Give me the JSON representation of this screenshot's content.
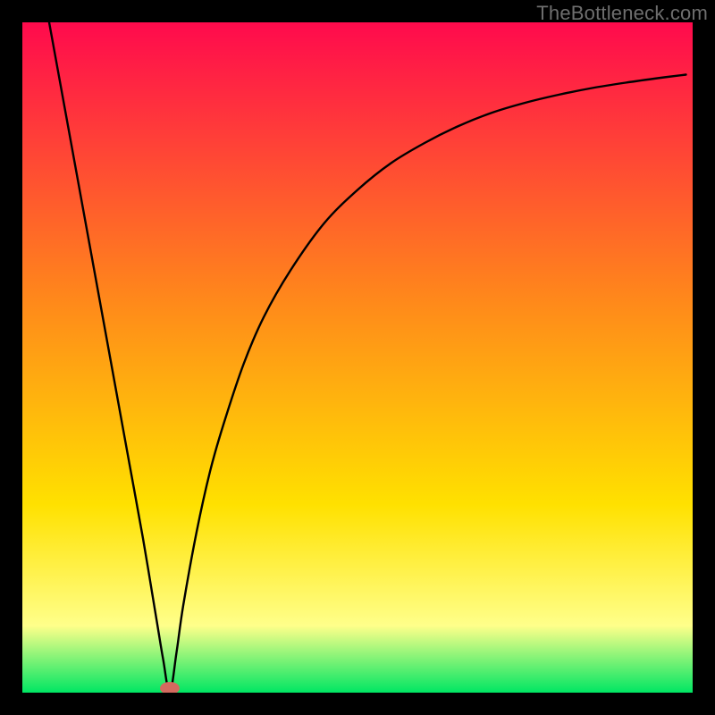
{
  "watermark": "TheBottleneck.com",
  "chart_data": {
    "type": "line",
    "title": "",
    "xlabel": "",
    "ylabel": "",
    "xlim": [
      0,
      100
    ],
    "ylim": [
      0,
      100
    ],
    "grid": false,
    "legend": false,
    "annotations": [],
    "marker": {
      "x": 22,
      "y": 0,
      "color": "#d46a5f"
    },
    "background_gradient": {
      "top": "#ff0a4d",
      "mid1": "#ff8a1a",
      "mid2": "#ffe100",
      "band": "#ffff8a",
      "bottom": "#00e663"
    },
    "series": [
      {
        "name": "curve",
        "color": "#000000",
        "x": [
          4,
          6,
          8,
          10,
          12,
          14,
          16,
          18,
          20,
          21,
          22,
          23,
          24,
          26,
          28,
          30,
          33,
          36,
          40,
          45,
          50,
          55,
          60,
          65,
          70,
          75,
          80,
          85,
          90,
          95,
          99
        ],
        "values": [
          100,
          89,
          78,
          67,
          56,
          45,
          34,
          23,
          11,
          5,
          0,
          6,
          13,
          24,
          33,
          40,
          49,
          56,
          63,
          70,
          75,
          79,
          82,
          84.5,
          86.5,
          88,
          89.2,
          90.2,
          91,
          91.7,
          92.2
        ]
      }
    ]
  }
}
